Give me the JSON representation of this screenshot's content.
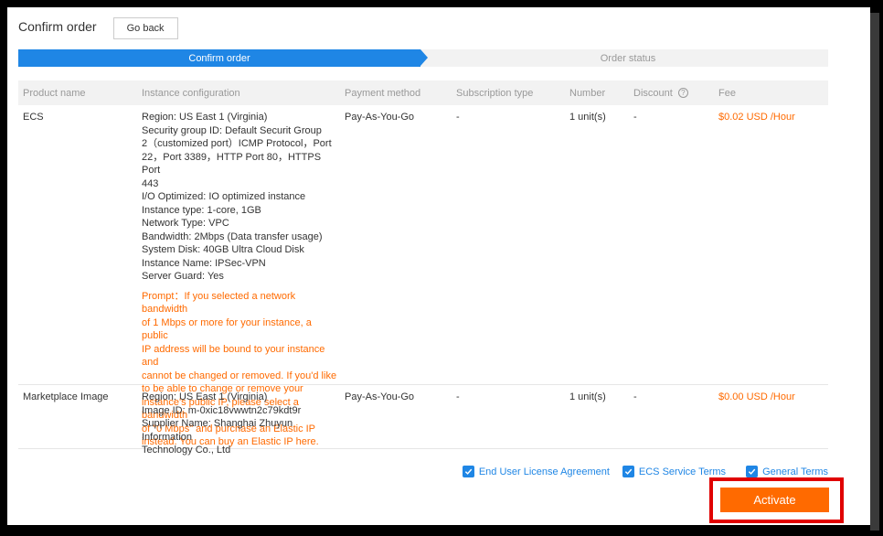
{
  "header": {
    "title": "Confirm order",
    "go_back_label": "Go back"
  },
  "steps": [
    {
      "label": "Confirm order",
      "active": true
    },
    {
      "label": "Order status",
      "active": false
    }
  ],
  "table": {
    "columns": [
      "Product name",
      "Instance configuration",
      "Payment method",
      "Subscription type",
      "Number",
      "Discount",
      "Fee"
    ],
    "rows": [
      {
        "product": "ECS",
        "config": [
          "Region: US East 1 (Virginia)",
          "Security group ID: Default Securit Group",
          "2（customized port）ICMP Protocol，Port",
          "22，Port 3389，HTTP Port 80，HTTPS Port",
          "443",
          "I/O Optimized: IO optimized instance",
          "Instance type: 1-core, 1GB",
          "Network Type: VPC",
          "Bandwidth: 2Mbps (Data transfer usage)",
          "System Disk: 40GB Ultra Cloud Disk",
          "Instance Name: IPSec-VPN",
          "Server Guard:  Yes"
        ],
        "prompt_label": "Prompt：",
        "prompt": [
          "If you selected a network bandwidth",
          "of 1 Mbps or more for your instance, a public",
          "IP address will be bound to your instance and",
          "cannot be changed or removed. If you'd like",
          "to be able to change or remove your",
          "instance's public IP, please select a bandwidth",
          "of \"0 Mbps\" and purchase an Elastic IP",
          "instead. You can buy an Elastic IP here."
        ],
        "payment": "Pay-As-You-Go",
        "subscription": "-",
        "number": "1  unit(s)",
        "discount": "-",
        "fee": "$0.02 USD /Hour"
      },
      {
        "product": "Marketplace Image",
        "config": [
          "Region: US East 1 (Virginia)",
          "Image ID: m-0xic18vwwtn2c79kdt9r",
          "Supplier Name: Shanghai Zhuyun Information",
          "Technology Co., Ltd"
        ],
        "payment": "Pay-As-You-Go",
        "subscription": "-",
        "number": "1  unit(s)",
        "discount": "-",
        "fee": "$0.00 USD /Hour"
      }
    ]
  },
  "terms": [
    {
      "label": "End User License Agreement",
      "checked": true
    },
    {
      "label": "ECS Service Terms",
      "checked": true
    },
    {
      "label": "General Terms",
      "checked": true
    }
  ],
  "activate_label": "Activate",
  "colors": {
    "accent": "#1f86e5",
    "fee": "#ff6a00",
    "activate": "#ff6a00",
    "highlight": "#e00000"
  },
  "icons": {
    "help": "question-circle-icon",
    "check": "checkmark-icon"
  }
}
